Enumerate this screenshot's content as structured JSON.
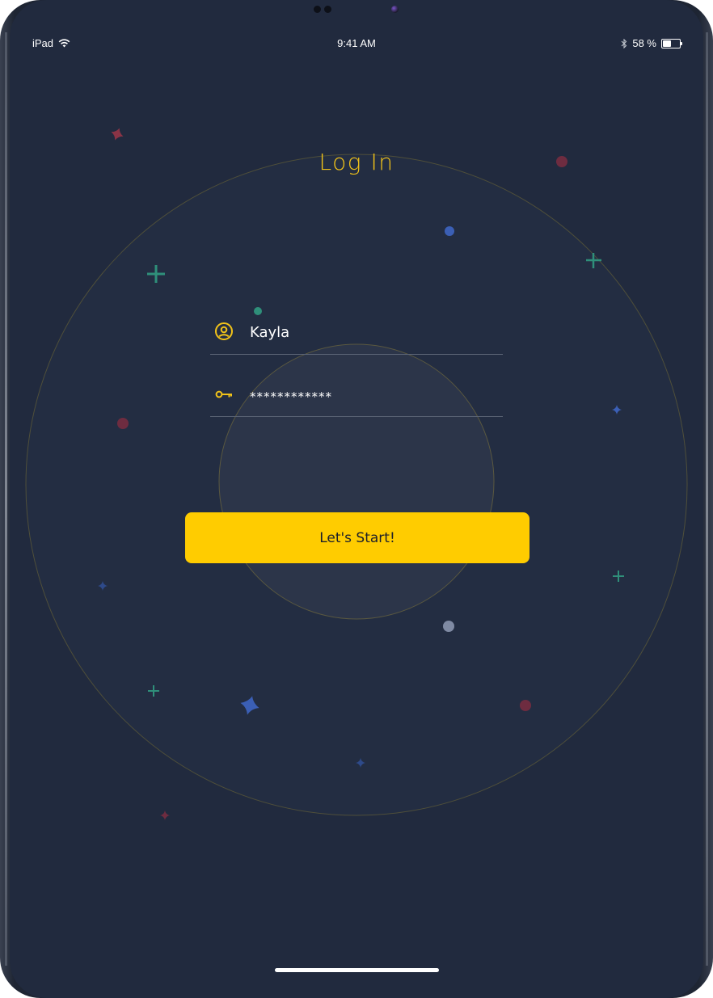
{
  "status_bar": {
    "device": "iPad",
    "time": "9:41 AM",
    "battery_text": "58 %",
    "battery_level": 0.58,
    "icons": [
      "wifi-icon",
      "bluetooth-icon",
      "battery-icon"
    ]
  },
  "login": {
    "title": "Log In",
    "username_value": "Kayla",
    "password_value": "************",
    "start_label": "Let's Start!"
  },
  "colors": {
    "background": "#212a3e",
    "accent": "#ffcc00",
    "title": "#f2c319",
    "decor_green": "#2f8f7a",
    "decor_red": "#8a3446",
    "decor_blue": "#3b5fb5"
  }
}
